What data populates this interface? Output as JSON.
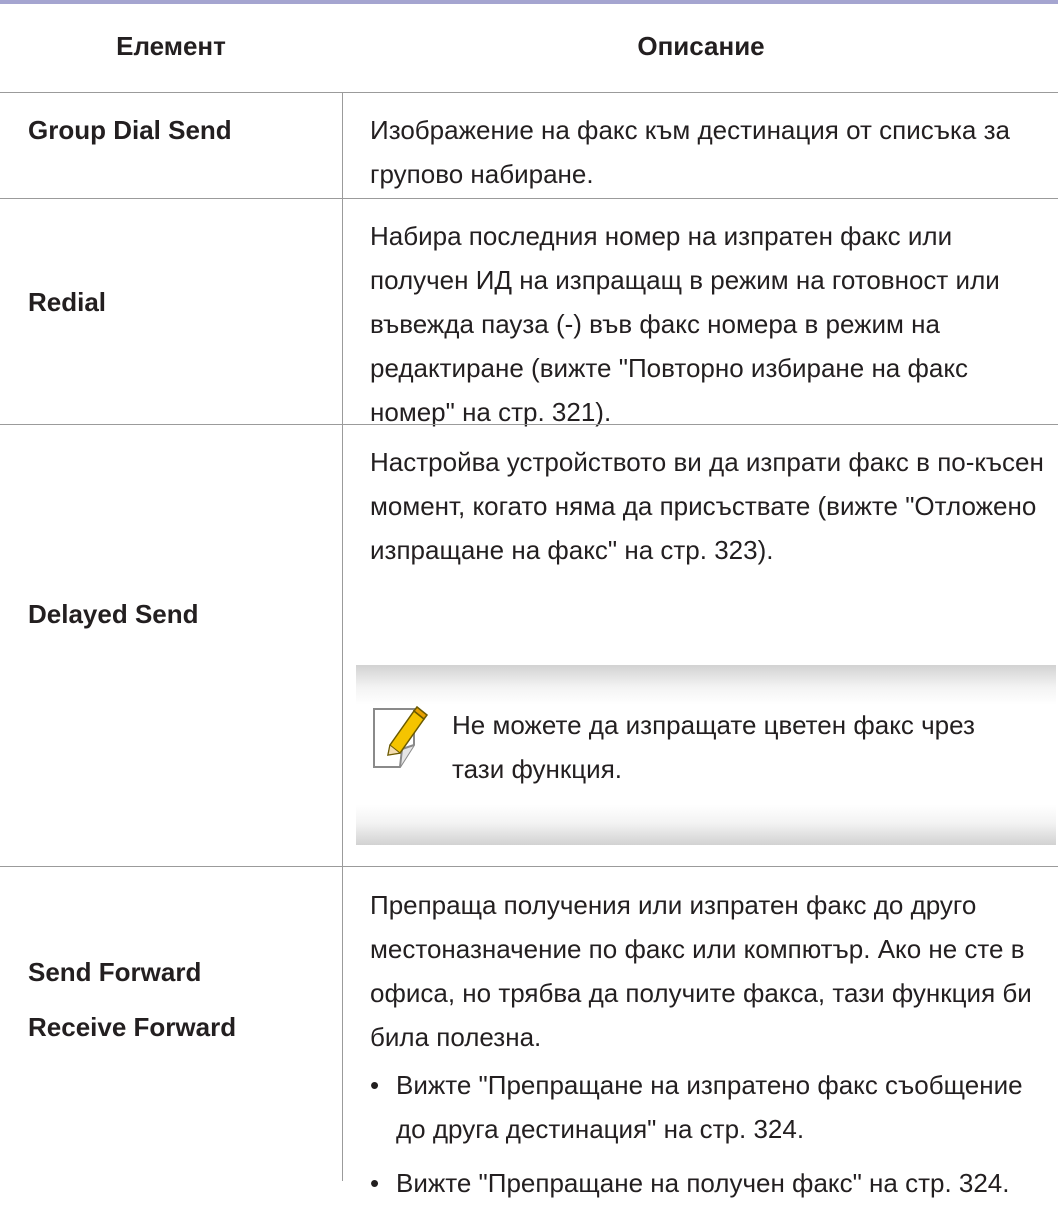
{
  "header": {
    "col_element": "Елемент",
    "col_description": "Описание"
  },
  "rows": [
    {
      "name": "Group Dial Send",
      "description": "Изображение на факс към дестинация от списъка за групово набиране."
    },
    {
      "name": "Redial",
      "description": "Набира последния номер на изпратен факс или получен ИД на изпращащ в режим на готовност или въвежда пауза (-) във факс номера в режим на редактиране (вижте \"Повторно избиране на факс номер\" на стр. 321)."
    },
    {
      "name": "Delayed Send",
      "description": "Настройва устройството ви да изпрати факс в по-късен момент, когато няма да присъствате (вижте \"Отложено изпращане на факс\" на стр. 323).",
      "note": "Не можете да изпращате цветен факс чрез тази функция.",
      "note_icon": "pencil-note-icon"
    },
    {
      "names": [
        "Send Forward",
        "Receive Forward"
      ],
      "description": "Препраща получения или изпратен факс до друго местоназначение по факс или компютър. Ако не сте в офиса, но трябва да получите факса, тази функция би била полезна.",
      "bullets": [
        "Вижте \"Препращане на изпратено факс съобщение до друга дестинация\" на стр. 324.",
        "Вижте \"Препращане на получен факс\" на стр. 324."
      ],
      "bullet_glyph": "•"
    }
  ]
}
